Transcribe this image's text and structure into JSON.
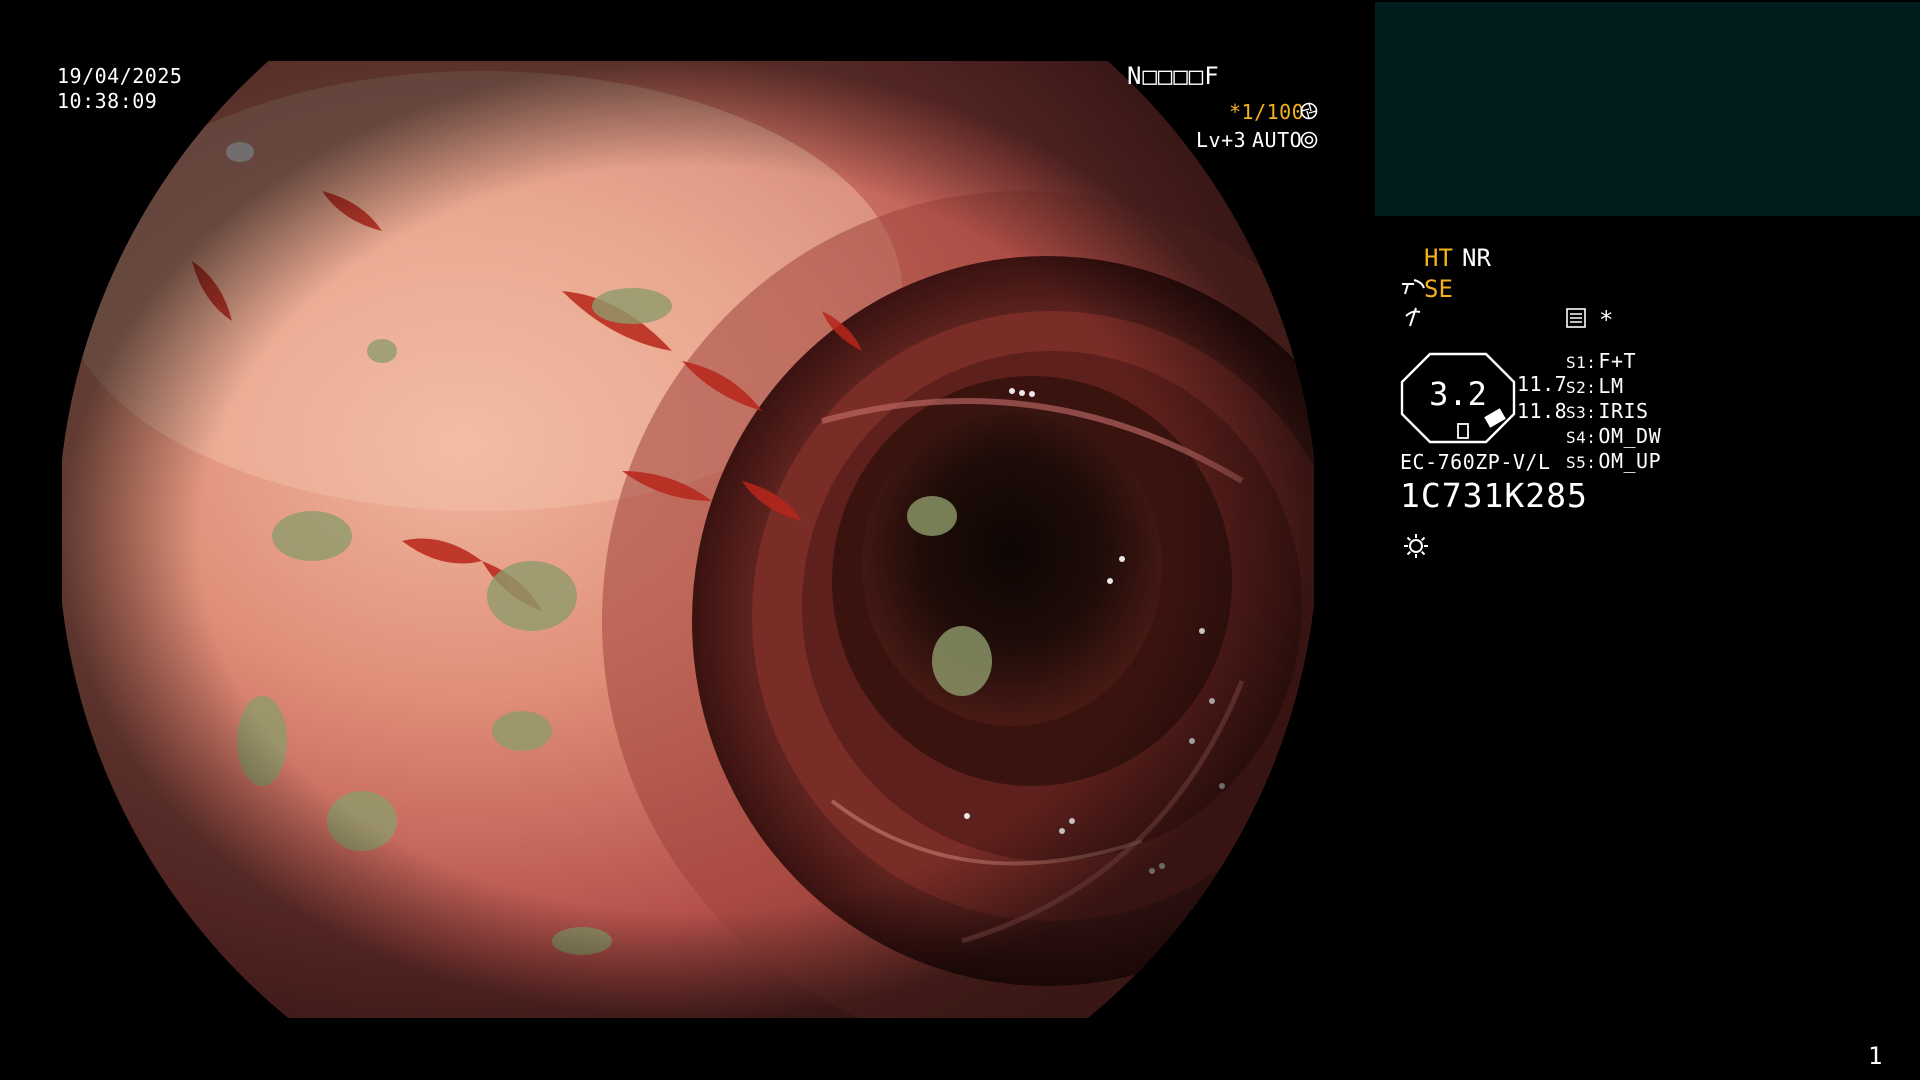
{
  "datetime": {
    "date": "19/04/2025",
    "time": "10:38:09"
  },
  "top_right": {
    "mode_code": "N□□□□F",
    "shutter": "*1/100",
    "level": "Lv+3",
    "iris_mode": "AUTO"
  },
  "status": {
    "ht": "HT",
    "nr": "NR",
    "se": "SE",
    "star": "*"
  },
  "gauge": {
    "value": "3.2",
    "reading_1": "11.7",
    "reading_2": "11.8"
  },
  "scope": {
    "model": "EC-760ZP-V/L",
    "serial": "1C731K285"
  },
  "switches": [
    {
      "slot": "S1:",
      "value": "F+T"
    },
    {
      "slot": "S2:",
      "value": "LM"
    },
    {
      "slot": "S3:",
      "value": "IRIS"
    },
    {
      "slot": "S4:",
      "value": "OM_DW"
    },
    {
      "slot": "S5:",
      "value": "OM_UP"
    }
  ],
  "page_number": "1",
  "icons": {
    "shutter_icon": "shutter-icon",
    "iris_icon": "iris-icon",
    "structure_enhance_icon": "structure-enhance-icon",
    "color_enhance_icon": "color-enhance-icon",
    "record_icon": "record-icon",
    "light_icon": "light-icon"
  },
  "colors": {
    "amber": "#f2b21e",
    "thumb_panel": "#011d1e",
    "mucosa": "#c9624f",
    "lumen": "#120705"
  }
}
